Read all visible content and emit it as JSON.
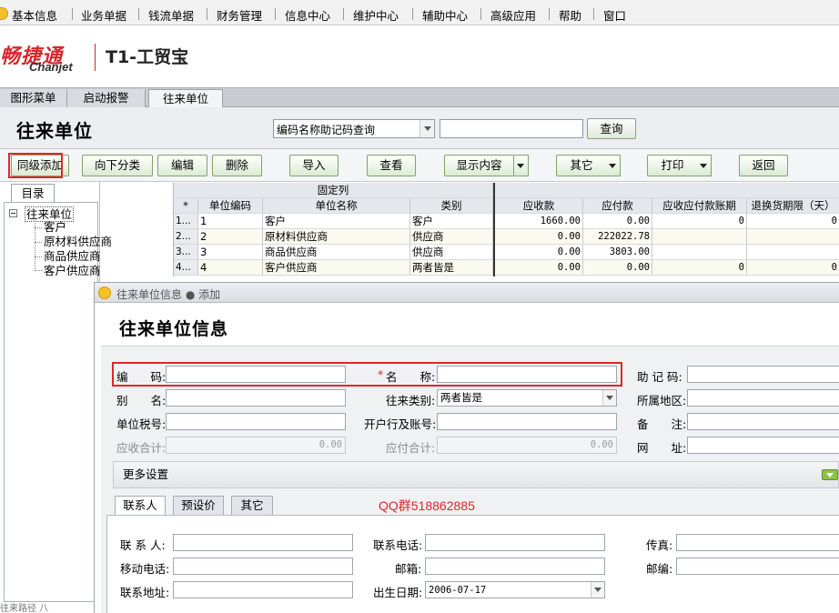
{
  "menu": {
    "items": [
      "基本信息",
      "业务单据",
      "钱流单据",
      "财务管理",
      "信息中心",
      "维护中心",
      "辅助中心",
      "高级应用",
      "帮助",
      "窗口"
    ]
  },
  "logo": {
    "brand_cn": "畅捷通",
    "brand_en": "Chanjet",
    "product": "T1-工贸宝"
  },
  "tabs": [
    "图形菜单",
    "启动报警",
    "往来单位"
  ],
  "page": {
    "title": "往来单位",
    "search_mode": "编码名称助记码查询",
    "search_value": "",
    "query_button": "查询"
  },
  "toolbar": {
    "same_level_add": "同级添加",
    "add_subcategory": "向下分类",
    "edit": "编辑",
    "delete": "删除",
    "import": "导入",
    "view": "查看",
    "display_content": "显示内容",
    "other": "其它",
    "print": "打印",
    "back": "返回"
  },
  "tree": {
    "tab_label": "目录",
    "root": "往来单位",
    "children": [
      "客户",
      "原材料供应商",
      "商品供应商",
      "客户供应商"
    ],
    "bottom_hint": "往来路径 八"
  },
  "grid": {
    "fixed_columns_label": "固定列",
    "row_header_symbol": "*",
    "columns": [
      "单位编码",
      "单位名称",
      "类别",
      "应收款",
      "应付款",
      "应收应付款账期",
      "退换货期限（天）"
    ],
    "rows": [
      {
        "rownum": "1...",
        "code": "1",
        "name": "客户",
        "type": "客户",
        "receivable": "1660.00",
        "payable": "0.00",
        "term": "0",
        "return_days": "0"
      },
      {
        "rownum": "2...",
        "code": "2",
        "name": "原材料供应商",
        "type": "供应商",
        "receivable": "0.00",
        "payable": "222022.78",
        "term": "",
        "return_days": ""
      },
      {
        "rownum": "3...",
        "code": "3",
        "name": "商品供应商",
        "type": "供应商",
        "receivable": "0.00",
        "payable": "3803.00",
        "term": "",
        "return_days": ""
      },
      {
        "rownum": "4...",
        "code": "4",
        "name": "客户供应商",
        "type": "两者皆是",
        "receivable": "0.00",
        "payable": "0.00",
        "term": "0",
        "return_days": "0"
      }
    ]
  },
  "dialog": {
    "title": "往来单位信息 ● 添加",
    "header": "往来单位信息",
    "labels": {
      "code": "编　　码:",
      "required_mark": "*",
      "name": "名　　称:",
      "mnemonic": "助 记 码:",
      "alias": "别　　名:",
      "category": "往来类别:",
      "region": "所属地区:",
      "tax_no": "单位税号:",
      "bank": "开户行及账号:",
      "remark": "备　　注:",
      "receivable_total": "应收合计:",
      "payable_total": "应付合计:",
      "website": "网　　址:"
    },
    "values": {
      "code": "",
      "name": "",
      "mnemonic": "",
      "alias": "",
      "category": "两者皆是",
      "region": "",
      "tax_no": "",
      "bank": "",
      "remark": "",
      "receivable_total": "0.00",
      "payable_total": "0.00",
      "website": ""
    },
    "more_settings": "更多设置",
    "sub_tabs": [
      "联系人",
      "预设价",
      "其它"
    ],
    "qq_note": "QQ群518862885",
    "contact": {
      "labels": {
        "contact_person": "联 系 人:",
        "phone": "联系电话:",
        "fax": "传真:",
        "mobile": "移动电话:",
        "email": "邮箱:",
        "zip": "邮编:",
        "address": "联系地址:",
        "birthday": "出生日期:"
      },
      "values": {
        "contact_person": "",
        "phone": "",
        "fax": "",
        "mobile": "",
        "email": "",
        "zip": "",
        "address": "",
        "birthday": "2006-07-17"
      }
    }
  }
}
